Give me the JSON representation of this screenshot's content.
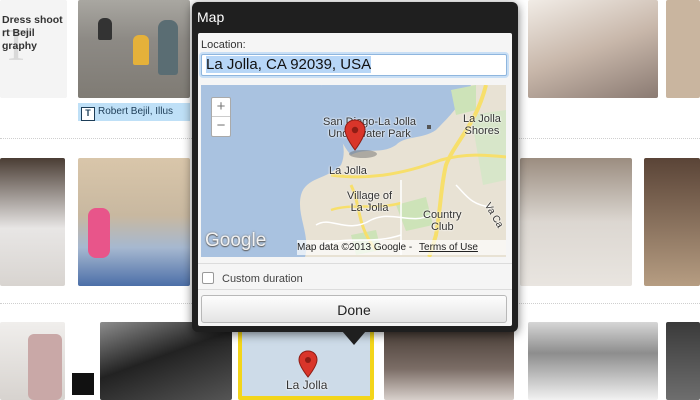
{
  "background": {
    "tile1_big_letter": "T",
    "tile1_text": "Dress shoot\nrt Bejil\ngraphy",
    "caption_tag": "Robert Bejil, Illus",
    "caption_icon": "text-icon",
    "mini_map_label": "La Jolla"
  },
  "popup": {
    "title": "Map",
    "location_label": "Location:",
    "location_value": "La Jolla, CA 92039, USA",
    "map": {
      "zoom_in": "+",
      "zoom_out": "−",
      "labels": {
        "la_jolla_shores": "La Jolla\nShores",
        "underwater_park": "San Diego-La Jolla\nUnderwater Park",
        "la_jolla": "La Jolla",
        "village": "Village of\nLa Jolla",
        "country_club": "Country\nClub",
        "la_cañada": "Va Ca"
      },
      "google_logo": "Google",
      "footer_data": "Map data ©2013 Google",
      "footer_terms": "Terms of Use",
      "pin_icon": "map-pin-icon"
    },
    "custom_duration_label": "Custom duration",
    "custom_duration_checked": false,
    "done_label": "Done"
  },
  "colors": {
    "popup_bg": "#1f1f1f",
    "input_focus": "#8fb6de",
    "selection": "#b7d6f7",
    "caption_tag_bg": "#bfe0f7",
    "highlight_border": "#f3d51a",
    "pin": "#d9352a"
  }
}
